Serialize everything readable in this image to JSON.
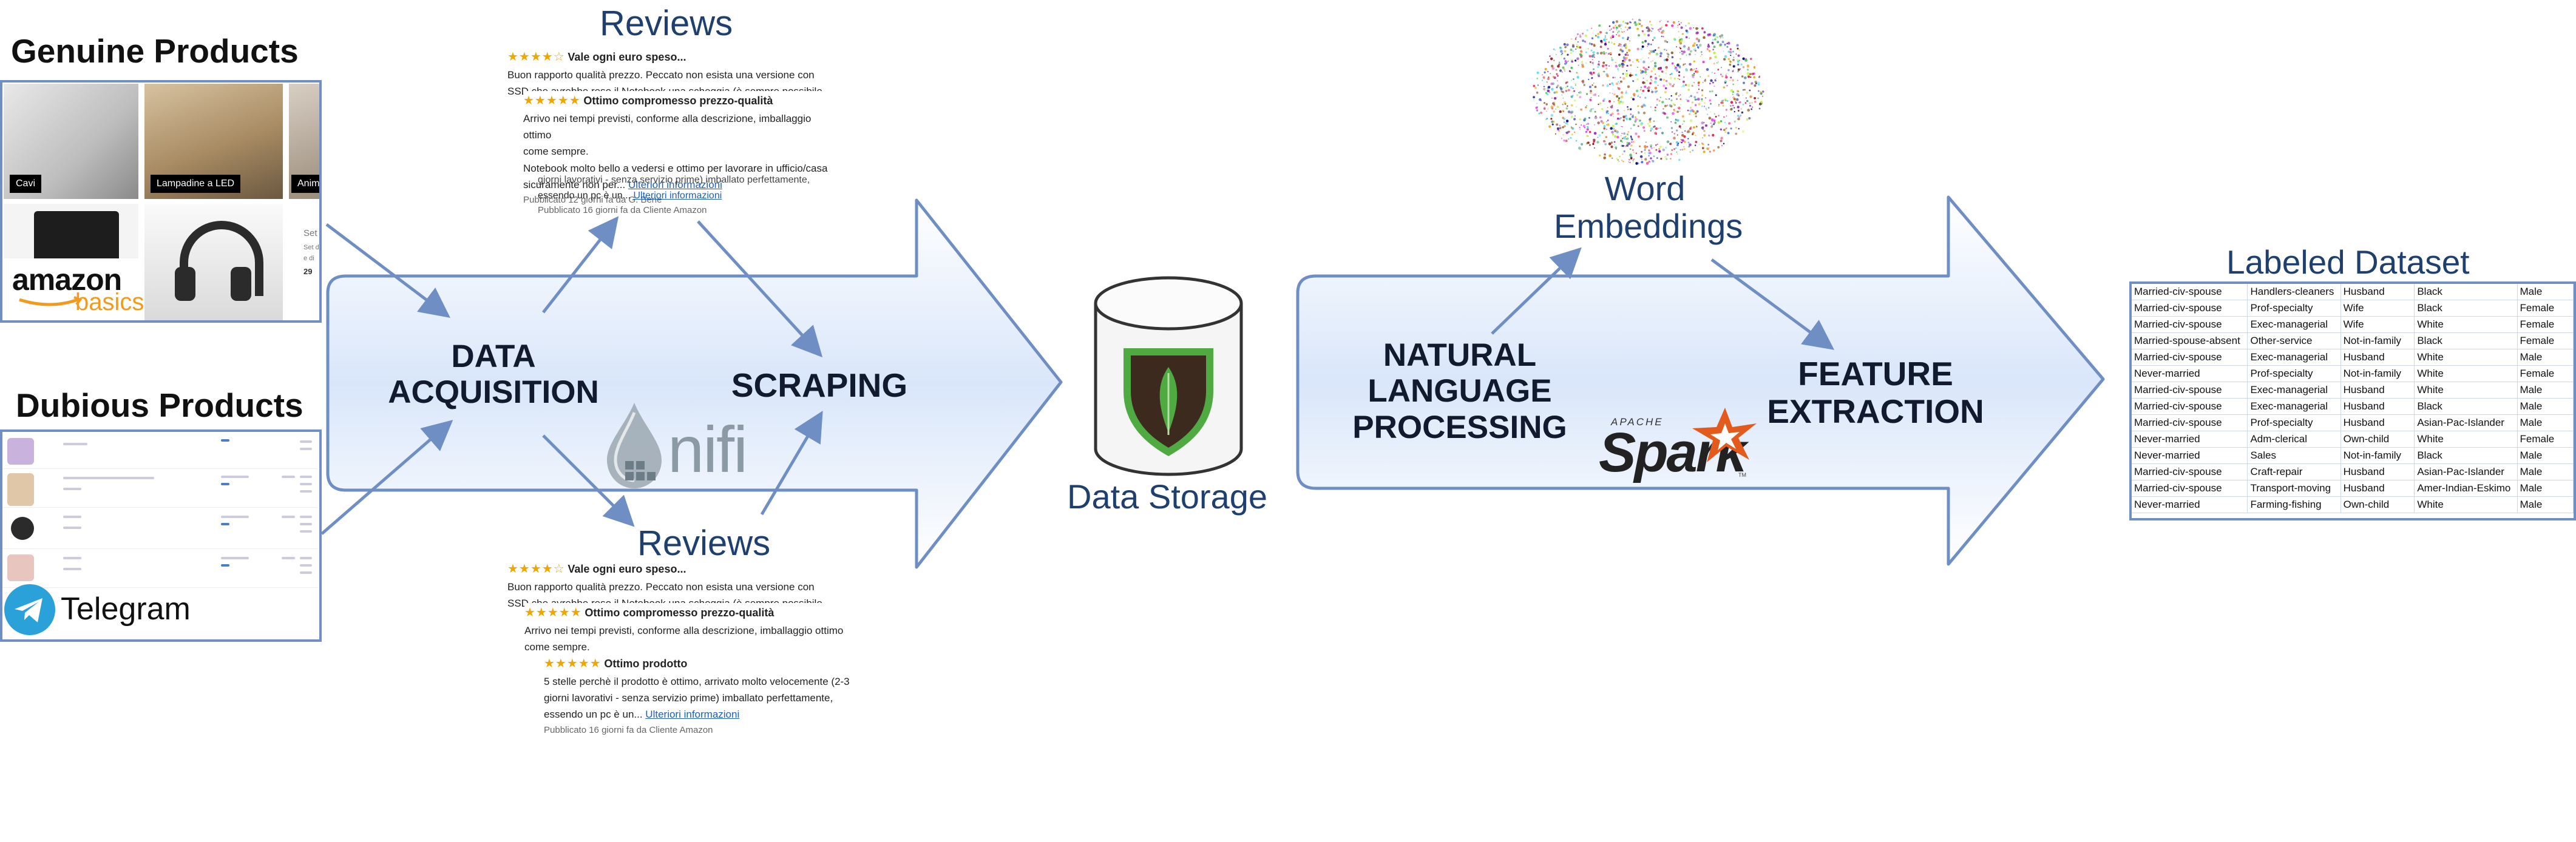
{
  "genuine": {
    "title": "Genuine Products",
    "tiles": [
      "Cavi",
      "Lampadine a LED",
      "Anim",
      "Set",
      "Set di",
      "e di",
      "29"
    ],
    "logo_top": "amazon",
    "logo_bottom": "basics"
  },
  "dubious": {
    "title": "Dubious Products",
    "telegram": "Telegram"
  },
  "stages": {
    "acquisition": [
      "DATA",
      "ACQUISITION"
    ],
    "scraping": "SCRAPING",
    "nlp": [
      "NATURAL",
      "LANGUAGE",
      "PROCESSING"
    ],
    "feature": [
      "FEATURE",
      "EXTRACTION"
    ]
  },
  "reviews_top": {
    "title": "Reviews",
    "r1": {
      "stars": "★★★★☆",
      "title": "Vale ogni euro speso...",
      "line1": "Buon rapporto qualità prezzo. Peccato non esista una versione con",
      "line2": "SSD che avrebbe reso il Notebook una scheggia (è sempre possibile"
    },
    "r2": {
      "stars": "★★★★★",
      "title": "Ottimo compromesso prezzo-qualità",
      "line1": "Arrivo nei tempi previsti, conforme alla descrizione, imballaggio ottimo",
      "line2": "come sempre.",
      "line3": "Notebook molto bello a vedersi e ottimo per lavorare in ufficio/casa",
      "line4": "sicuramente non per...",
      "link": "Ulteriori informazioni",
      "meta": "Pubblicato 12 giorni fa da G. Bene"
    },
    "r3": {
      "line1": "giorni lavorativi - senza servizio prime) imballato perfettamente,",
      "line2": "essendo un pc è un...",
      "link": "Ulteriori informazioni",
      "meta": "Pubblicato 16 giorni fa da Cliente Amazon"
    }
  },
  "reviews_bottom": {
    "title": "Reviews",
    "r1": {
      "stars": "★★★★☆",
      "title": "Vale ogni euro speso...",
      "line1": "Buon rapporto qualità prezzo. Peccato non esista una versione con",
      "line2": "SSD che avrebbe reso il Notebook una scheggia (è sempre possibile"
    },
    "r2": {
      "stars": "★★★★★",
      "title": "Ottimo compromesso prezzo-qualità",
      "line1": "Arrivo nei tempi previsti, conforme alla descrizione, imballaggio ottimo",
      "line2": "come sempre."
    },
    "r3": {
      "stars": "★★★★★",
      "title": "Ottimo prodotto",
      "line1": "5 stelle perchè il prodotto è ottimo, arrivato molto velocemente (2-3",
      "line2": "giorni lavorativi - senza servizio prime) imballato perfettamente,",
      "line3": "essendo un pc è un...",
      "link": "Ulteriori informazioni",
      "meta": "Pubblicato 16 giorni fa da Cliente Amazon"
    }
  },
  "nifi": "nifi",
  "storage": "Data Storage",
  "embeddings": [
    "Word",
    "Embeddings"
  ],
  "spark": {
    "apache": "APACHE",
    "name": "Spark",
    "tm": "TM"
  },
  "labeled": {
    "title": "Labeled Dataset",
    "rows": [
      [
        "Married-civ-spouse",
        "Handlers-cleaners",
        "Husband",
        "Black",
        "Male"
      ],
      [
        "Married-civ-spouse",
        "Prof-specialty",
        "Wife",
        "Black",
        "Female"
      ],
      [
        "Married-civ-spouse",
        "Exec-managerial",
        "Wife",
        "White",
        "Female"
      ],
      [
        "Married-spouse-absent",
        "Other-service",
        "Not-in-family",
        "Black",
        "Female"
      ],
      [
        "Married-civ-spouse",
        "Exec-managerial",
        "Husband",
        "White",
        "Male"
      ],
      [
        "Never-married",
        "Prof-specialty",
        "Not-in-family",
        "White",
        "Female"
      ],
      [
        "Married-civ-spouse",
        "Exec-managerial",
        "Husband",
        "White",
        "Male"
      ],
      [
        "Married-civ-spouse",
        "Exec-managerial",
        "Husband",
        "Black",
        "Male"
      ],
      [
        "Married-civ-spouse",
        "Prof-specialty",
        "Husband",
        "Asian-Pac-Islander",
        "Male"
      ],
      [
        "Never-married",
        "Adm-clerical",
        "Own-child",
        "White",
        "Female"
      ],
      [
        "Never-married",
        "Sales",
        "Not-in-family",
        "Black",
        "Male"
      ],
      [
        "Married-civ-spouse",
        "Craft-repair",
        "Husband",
        "Asian-Pac-Islander",
        "Male"
      ],
      [
        "Married-civ-spouse",
        "Transport-moving",
        "Husband",
        "Amer-Indian-Eskimo",
        "Male"
      ],
      [
        "Never-married",
        "Farming-fishing",
        "Own-child",
        "White",
        "Male"
      ]
    ]
  },
  "colors": {
    "arrow_fill": "#dbe8fb",
    "arrow_stroke": "#6f8fc4",
    "title_blue": "#1f3f6e",
    "mongo_green": "#4faa41"
  }
}
